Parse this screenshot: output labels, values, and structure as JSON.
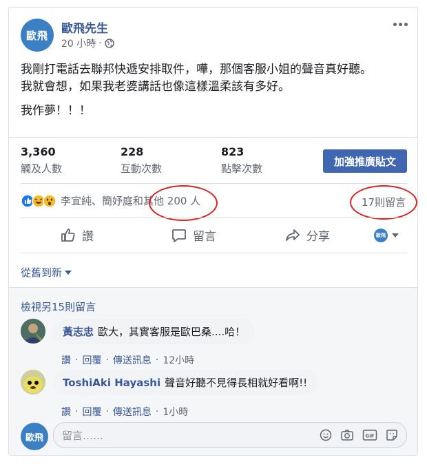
{
  "post": {
    "author": "歐飛先生",
    "avatar_text": "歐飛",
    "time": "20 小時",
    "line1": "我剛打電話去聯邦快遞安排取件，嘩，那個客服小姐的聲音真好聽。",
    "line2": "我就會想，如果我老婆講話也像這樣溫柔該有多好。",
    "line3": "我作夢！！！"
  },
  "stats": [
    {
      "value": "3,360",
      "label": "觸及人數"
    },
    {
      "value": "228",
      "label": "互動次數"
    },
    {
      "value": "823",
      "label": "點擊次數"
    }
  ],
  "boost_label": "加強推廣貼文",
  "reactions": {
    "names": "李宜純、簡妤庭和其他 200 人",
    "comment_count": "17則留言"
  },
  "actions": {
    "like": "讚",
    "comment": "留言",
    "share": "分享",
    "page_avatar": "歐飛"
  },
  "sort_label": "從舊到新",
  "more_comments": "檢視另15則留言",
  "comments": [
    {
      "author": "黃志忠",
      "text": "歐大，其實客服是歐巴桑....哈！",
      "like": "讚",
      "reply": "回覆",
      "message": "傳送訊息",
      "time": "12小時"
    },
    {
      "author": "ToshiAki Hayashi",
      "text": "聲音好聽不見得長相就好看啊!!",
      "like": "讚",
      "reply": "回覆",
      "message": "傳送訊息",
      "time": "1小時"
    }
  ],
  "composer": {
    "avatar_text": "歐飛",
    "placeholder": "留言……"
  },
  "colors": {
    "brand_blue": "#4267b2",
    "link_blue": "#385898",
    "annotation_red": "#e0201f"
  }
}
